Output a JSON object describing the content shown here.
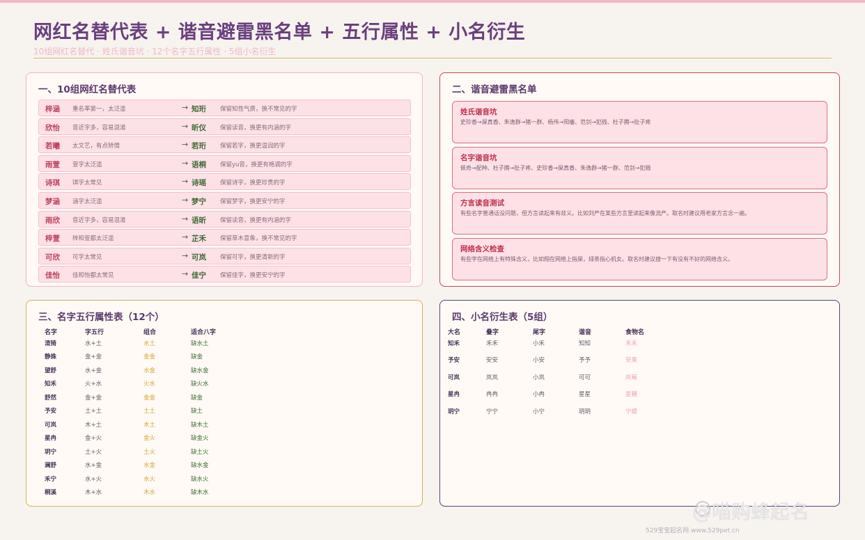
{
  "header": {
    "title": "网红名替代表 + 谐音避雷黑名单 + 五行属性 + 小名衍生",
    "subtitle": "10组网红名替代 · 姓氏谐音坑 · 12个名字五行属性 · 5组小名衍生"
  },
  "section1": {
    "title": "一、10组网红名替代表",
    "rows": [
      {
        "orig": "梓涵",
        "problem": "重名率第一，太泛滥",
        "arrow": "→",
        "new": "知珩",
        "note": "保留知性气质，换不常见的字"
      },
      {
        "orig": "欣怡",
        "problem": "音近字多，容易混淆",
        "arrow": "→",
        "new": "昕仪",
        "note": "保留读音，换更有内涵的字"
      },
      {
        "orig": "若曦",
        "problem": "太文艺，有点矫情",
        "arrow": "→",
        "new": "若珩",
        "note": "保留若字，换更温润的字"
      },
      {
        "orig": "雨萱",
        "problem": "萱字太泛滥",
        "arrow": "→",
        "new": "语桐",
        "note": "保留yu音，换更有格调的字"
      },
      {
        "orig": "诗琪",
        "problem": "琪字太常见",
        "arrow": "→",
        "new": "诗瑶",
        "note": "保留诗字，换更珍贵的字"
      },
      {
        "orig": "梦涵",
        "problem": "涵字太泛滥",
        "arrow": "→",
        "new": "梦宁",
        "note": "保留梦字，换更安宁的字"
      },
      {
        "orig": "雨欣",
        "problem": "音近字多，容易混淆",
        "arrow": "→",
        "new": "语昕",
        "note": "保留读音，换更有内涵的字"
      },
      {
        "orig": "梓萱",
        "problem": "梓和萱都太泛滥",
        "arrow": "→",
        "new": "芷禾",
        "note": "保留草木意象，换不常见的字"
      },
      {
        "orig": "可欣",
        "problem": "可字太常见",
        "arrow": "→",
        "new": "可岚",
        "note": "保留可字，换更清新的字"
      },
      {
        "orig": "佳怡",
        "problem": "佳和怡都太常见",
        "arrow": "→",
        "new": "佳宁",
        "note": "保留佳字，换更安宁的字"
      }
    ]
  },
  "section2": {
    "title": "二、谐音避雷黑名单",
    "cards": [
      {
        "title": "姓氏谐音坑",
        "body": "史珍香→屎真香、朱逸群→猪一群、杨伟→阳痿、范剑→犯贱、杜子腾→肚子疼"
      },
      {
        "title": "名字谐音坑",
        "body": "佩奇→配种、杜子腾→肚子疼、史珍香→屎真香、朱逸群→猪一群、范剑→犯贱"
      },
      {
        "title": "方言读音测试",
        "body": "有些名字普通话没问题，但方言读起来有歧义。比如刘产在某些方言里读起来像流产。取名时建议用老家方言念一遍。"
      },
      {
        "title": "网络含义检查",
        "body": "有些字在网络上有特殊含义，比如翔在网络上指屎，绿茶指心机女。取名时建议搜一下有没有不好的网络含义。"
      }
    ]
  },
  "section3": {
    "title": "三、名字五行属性表（12个）",
    "headers": [
      "名字",
      "字五行",
      "组合",
      "适合八字"
    ],
    "rows": [
      {
        "name": "清猗",
        "wuxing": "水+土",
        "combo": "水土",
        "bazi": "缺水土"
      },
      {
        "name": "静姝",
        "wuxing": "金+金",
        "combo": "金金",
        "bazi": "缺金"
      },
      {
        "name": "望舒",
        "wuxing": "水+金",
        "combo": "水金",
        "bazi": "缺水金"
      },
      {
        "name": "知禾",
        "wuxing": "火+水",
        "combo": "火水",
        "bazi": "缺火水"
      },
      {
        "name": "舒然",
        "wuxing": "金+金",
        "combo": "金金",
        "bazi": "缺金"
      },
      {
        "name": "予安",
        "wuxing": "土+土",
        "combo": "土土",
        "bazi": "缺土"
      },
      {
        "name": "可岚",
        "wuxing": "木+土",
        "combo": "木土",
        "bazi": "缺木土"
      },
      {
        "name": "星冉",
        "wuxing": "金+火",
        "combo": "金火",
        "bazi": "缺金火"
      },
      {
        "name": "玥宁",
        "wuxing": "土+火",
        "combo": "土火",
        "bazi": "缺土火"
      },
      {
        "name": "澜舒",
        "wuxing": "水+金",
        "combo": "水金",
        "bazi": "缺水金"
      },
      {
        "name": "禾宁",
        "wuxing": "水+火",
        "combo": "水火",
        "bazi": "缺水火"
      },
      {
        "name": "桐溪",
        "wuxing": "木+水",
        "combo": "木水",
        "bazi": "缺木水"
      }
    ]
  },
  "section4": {
    "title": "四、小名衍生表（5组）",
    "headers": [
      "大名",
      "叠字",
      "尾字",
      "谐音",
      "食物名"
    ],
    "rows": [
      {
        "name": "知禾",
        "die": "禾禾",
        "wei": "小禾",
        "xie": "知知",
        "food": "禾禾"
      },
      {
        "name": "予安",
        "die": "安安",
        "wei": "小安",
        "xie": "予予",
        "food": "安果"
      },
      {
        "name": "可岚",
        "die": "岚岚",
        "wei": "小岚",
        "xie": "可可",
        "food": "岚莓"
      },
      {
        "name": "星冉",
        "die": "冉冉",
        "wei": "小冉",
        "xie": "星星",
        "food": "星糖"
      },
      {
        "name": "玥宁",
        "die": "宁宁",
        "wei": "小宁",
        "xie": "玥玥",
        "food": "宁檬"
      }
    ]
  },
  "watermark": "@喵购蜂起名",
  "footer": "529宝宝起名网  www.529pet.cn"
}
